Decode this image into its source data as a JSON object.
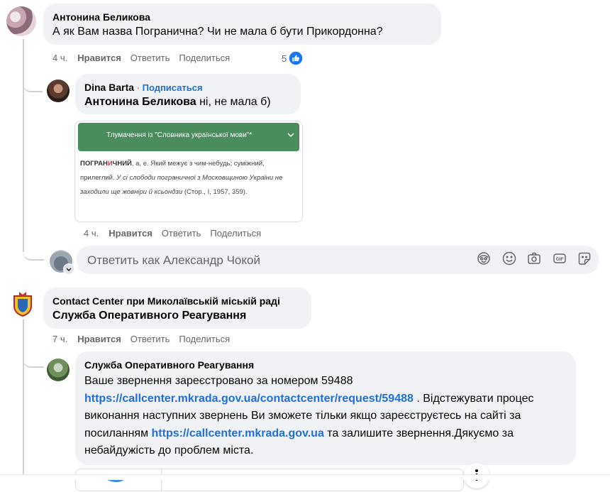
{
  "comments": [
    {
      "author": "Антонина Беликова",
      "text": "А як Вам назва Погранична? Чи не мала б бути Прикордонна?",
      "time": "4 ч.",
      "actions": {
        "like": "Нравится",
        "reply": "Ответить",
        "share": "Поделиться"
      },
      "reaction_count": "5"
    },
    {
      "author": "Dina Barta",
      "separator": " · ",
      "follow": "Подписаться",
      "mention": "Антонина Беликова",
      "text": " ні, не мала б)",
      "time": "4 ч.",
      "actions": {
        "like": "Нравится",
        "reply": "Ответить",
        "share": "Поделиться"
      },
      "attachment": {
        "header": "Тлумачення із \"Словника української мови\"*",
        "word_prefix": "ПОГРАН",
        "word_stress": "И",
        "word_suffix": "ЧНИЙ",
        "definition": ", а, е. Який межує з чим-небудь; суміжний, прилеглий.",
        "example": " У сі слободи пограничної з Московщиною України не заходили ще жовніри й ксьондзи",
        "source": " (Стор., І, 1957, 359)."
      }
    },
    {
      "author": "Contact Center при Миколаївській міській раді",
      "text": "Служба Оперативного Реагування",
      "time": "7 ч.",
      "actions": {
        "like": "Нравится",
        "reply": "Ответить",
        "share": "Поделиться"
      }
    },
    {
      "author": "Служба Оперативного Реагування",
      "text1": "Ваше звернення зареєстровано за номером 59488",
      "link1": "https://callcenter.mkrada.gov.ua/contactcenter/request/59488",
      "text2": " . Відстежувати процес виконання наступних звернень Ви зможете тільки якщо зареєструєтесь на сайті за посиланням ",
      "link2": "https://callcenter.mkrada.gov.ua",
      "text3": " та залишите звернення.Дякуємо за небайдужість до проблем міста."
    }
  ],
  "reply_box": {
    "placeholder": "Ответить как Александр Чокой",
    "icons": [
      "avatar-sticker-icon",
      "emoji-icon",
      "camera-icon",
      "gif-icon",
      "sticker-icon"
    ]
  },
  "colors": {
    "bubble": "#f0f2f5",
    "link": "#216fdb",
    "secondary_text": "#65676b",
    "like_blue": "#1877f2",
    "dictionary_header": "#4a8c5c",
    "stress_red": "#e0342f"
  }
}
